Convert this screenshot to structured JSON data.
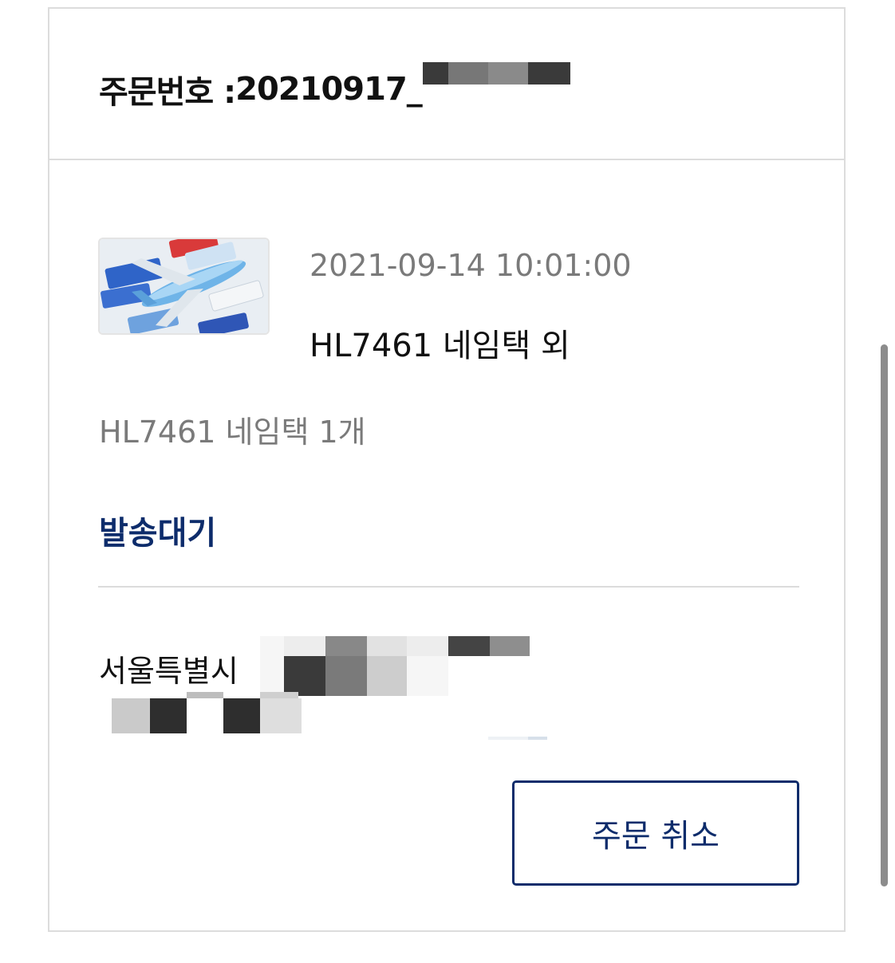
{
  "order": {
    "number_label": "주문번호 : ",
    "number_value": "20210917_"
  },
  "item": {
    "image_alt": "airplane model with name tags",
    "date": "2021-09-14 10:01:00",
    "title": "HL7461 네임택 외",
    "option": "HL7461 네임택 1개",
    "status": "발송대기"
  },
  "shipping": {
    "address": "서울특별시"
  },
  "actions": {
    "cancel_label": "주문 취소"
  },
  "colors": {
    "accent": "#0d2c6b",
    "muted_text": "#7a7a7a",
    "border": "#dcdcdc"
  }
}
